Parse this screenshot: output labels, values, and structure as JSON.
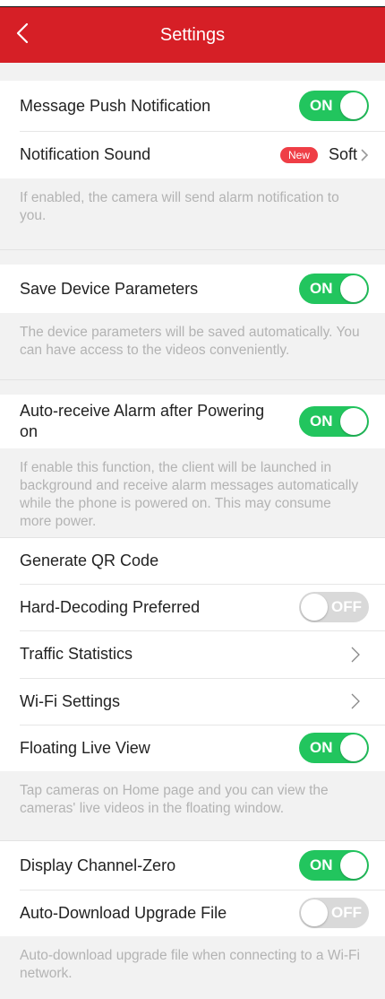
{
  "header": {
    "title": "Settings"
  },
  "colors": {
    "brand_red": "#d61f26",
    "toggle_on": "#22c55e",
    "toggle_off": "#d9d9d9",
    "badge": "#ef3e46"
  },
  "toggle_text": {
    "on": "ON",
    "off": "OFF"
  },
  "settings": {
    "message_push": {
      "label": "Message Push Notification",
      "state": "on"
    },
    "notification_sound": {
      "label": "Notification Sound",
      "badge": "New",
      "value": "Soft"
    },
    "notification_desc": "If enabled, the camera will send alarm notification to you.",
    "save_params": {
      "label": "Save Device Parameters",
      "state": "on"
    },
    "save_params_desc": "The device parameters will be saved automatically. You can have access to the videos conveniently.",
    "auto_receive": {
      "label": "Auto-receive Alarm after Powering on",
      "state": "on"
    },
    "auto_receive_desc": "If enable this function, the client will be launched in background and receive alarm messages automatically while the phone is powered on. This may consume more power.",
    "generate_qr": {
      "label": "Generate QR Code"
    },
    "hard_decoding": {
      "label": "Hard-Decoding Preferred",
      "state": "off"
    },
    "traffic_stats": {
      "label": "Traffic Statistics"
    },
    "wifi_settings": {
      "label": "Wi-Fi Settings"
    },
    "floating_live": {
      "label": "Floating Live View",
      "state": "on"
    },
    "floating_live_desc": "Tap cameras on Home page and you can view the cameras' live videos in the floating window.",
    "channel_zero": {
      "label": "Display Channel-Zero",
      "state": "on"
    },
    "auto_download": {
      "label": "Auto-Download Upgrade File",
      "state": "off"
    },
    "auto_download_desc": "Auto-download upgrade file when connecting to a Wi-Fi network."
  }
}
